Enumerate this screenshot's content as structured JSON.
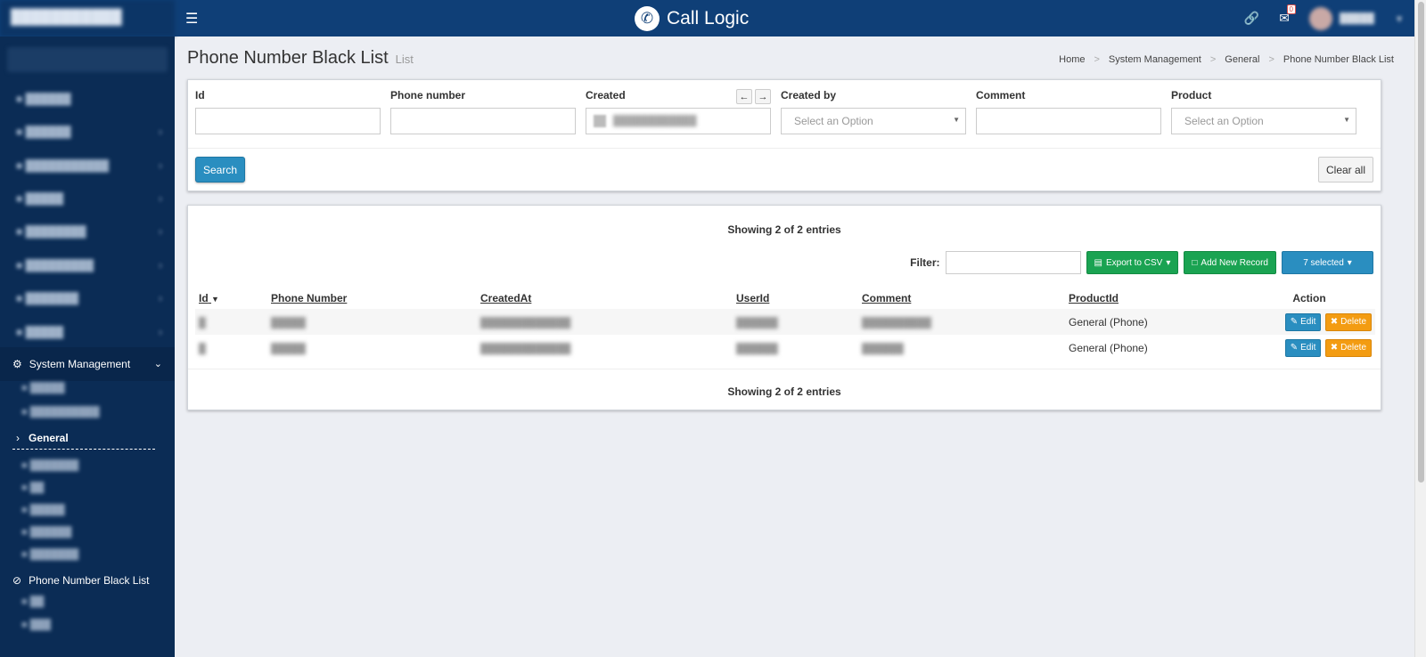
{
  "app": {
    "brand_name": "Call Logic",
    "notification_count": "0"
  },
  "sidebar": {
    "group_active": "System Management",
    "sub_active": "General",
    "current_page": "Phone Number Black List"
  },
  "page": {
    "title": "Phone Number Black List",
    "subtitle": "List"
  },
  "breadcrumb": [
    "Home",
    "System Management",
    "General",
    "Phone Number Black List"
  ],
  "filters": {
    "id_label": "Id",
    "phone_label": "Phone number",
    "created_label": "Created",
    "created_by_label": "Created by",
    "created_by_placeholder": "Select an Option",
    "comment_label": "Comment",
    "product_label": "Product",
    "product_placeholder": "Select an Option",
    "search_button": "Search",
    "clear_button": "Clear all"
  },
  "table": {
    "showing_top": "Showing 2 of 2 entries",
    "showing_bottom": "Showing 2 of 2 entries",
    "filter_label": "Filter:",
    "export_button": "Export to CSV",
    "add_button": "Add New Record",
    "selected_button": "7 selected",
    "columns": [
      "Id",
      "Phone Number",
      "CreatedAt",
      "UserId",
      "Comment",
      "ProductId",
      "Action"
    ],
    "rows": [
      {
        "product": "General (Phone)",
        "edit": "Edit",
        "delete": "Delete"
      },
      {
        "product": "General (Phone)",
        "edit": "Edit",
        "delete": "Delete"
      }
    ]
  },
  "colors": {
    "topbar": "#0f3f77",
    "sidebar": "#0b2c55",
    "primary": "#2a8ec0",
    "success": "#1aa352",
    "warning": "#f39c12"
  }
}
